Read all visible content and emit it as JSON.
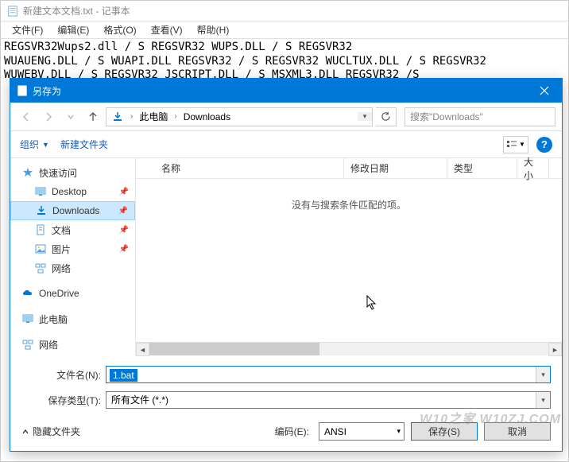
{
  "notepad": {
    "title": "新建文本文档.txt - 记事本",
    "menu": {
      "file": "文件(F)",
      "edit": "编辑(E)",
      "format": "格式(O)",
      "view": "查看(V)",
      "help": "帮助(H)"
    },
    "content": "REGSVR32Wups2.dll / S REGSVR32 WUPS.DLL / S REGSVR32\nWUAUENG.DLL / S WUAPI.DLL REGSVR32 / S REGSVR32 WUCLTUX.DLL / S REGSVR32\nWUWEBV.DLL / S REGSVR32 JSCRIPT.DLL / S MSXML3.DLL REGSVR32 /S"
  },
  "dialog": {
    "title": "另存为",
    "breadcrumb": {
      "root": "此电脑",
      "folder": "Downloads"
    },
    "search_placeholder": "搜索\"Downloads\"",
    "toolbar": {
      "organize": "组织",
      "new_folder": "新建文件夹"
    },
    "tree": {
      "quick_access": "快速访问",
      "desktop": "Desktop",
      "downloads": "Downloads",
      "documents": "文档",
      "pictures": "图片",
      "network_sub": "网络",
      "onedrive": "OneDrive",
      "this_pc": "此电脑",
      "network": "网络"
    },
    "columns": {
      "name": "名称",
      "date": "修改日期",
      "type": "类型",
      "size": "大小"
    },
    "empty_message": "没有与搜索条件匹配的项。",
    "form": {
      "filename_label": "文件名(N):",
      "filename_value": "1.bat",
      "filetype_label": "保存类型(T):",
      "filetype_value": "所有文件 (*.*)"
    },
    "footer": {
      "hide_folders": "隐藏文件夹",
      "encoding_label": "编码(E):",
      "encoding_value": "ANSI",
      "save": "保存(S)",
      "cancel": "取消"
    }
  },
  "watermark": "W10之家 W10ZJ.COM"
}
